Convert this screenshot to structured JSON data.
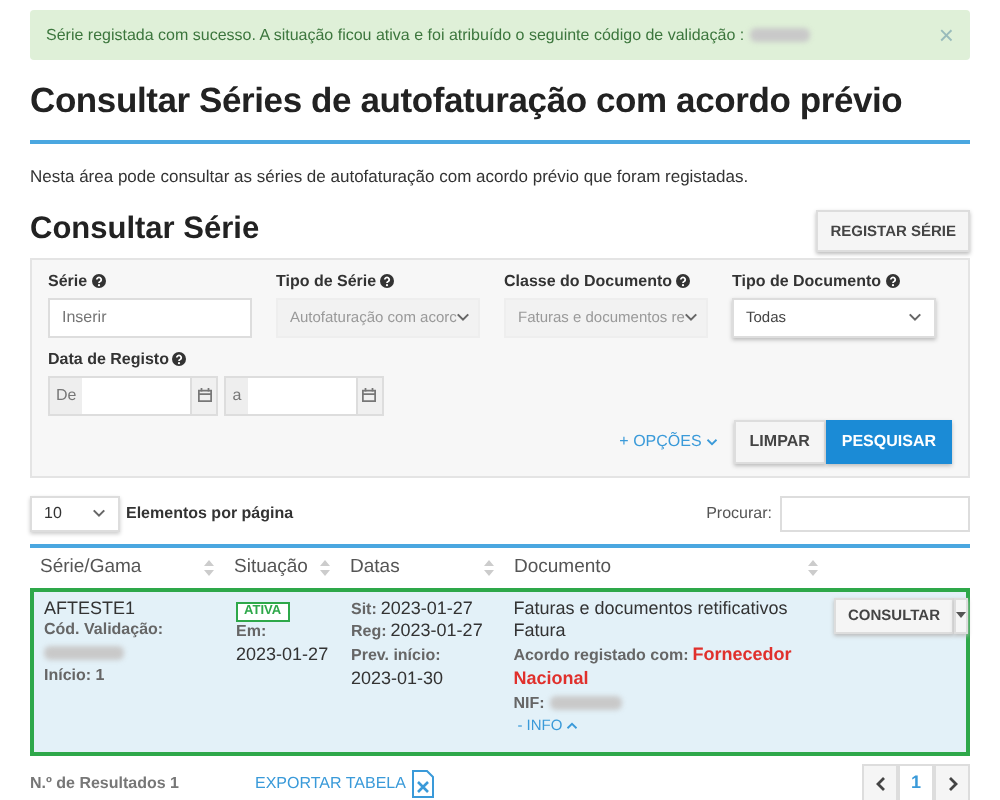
{
  "alert": {
    "text": "Série registada com sucesso. A situação ficou ativa e foi atribuído o seguinte código de validação :",
    "redacted": true,
    "dismiss": "×"
  },
  "title": "Consultar Séries de autofaturação com acordo prévio",
  "intro": "Nesta área pode consultar as séries de autofaturação com acordo prévio que foram registadas.",
  "section_title": "Consultar Série",
  "register_button": "REGISTAR SÉRIE",
  "filters": [
    {
      "kind": "input",
      "label": "Série",
      "placeholder": "Inserir"
    },
    {
      "kind": "select",
      "label": "Tipo de Série",
      "value": "Autofaturação com acorc",
      "disabled": true
    },
    {
      "kind": "select",
      "label": "Classe do Documento",
      "value": "Faturas e documentos re",
      "disabled": true
    },
    {
      "kind": "select",
      "label": "Tipo de Documento",
      "value": "Todas",
      "disabled": false
    },
    {
      "kind": "daterange",
      "label": "Data de Registo",
      "from": "De",
      "to": "a"
    }
  ],
  "options_link": "+ OPÇÕES",
  "buttons": [
    {
      "label": "LIMPAR",
      "primary": false
    },
    {
      "label": "PESQUISAR",
      "primary": true
    }
  ],
  "page_size": {
    "value": "10",
    "label": "Elementos por página"
  },
  "search": {
    "label": "Procurar:"
  },
  "table": {
    "columns": [
      {
        "label": "Série/Gama",
        "sortable": true
      },
      {
        "label": "Situação",
        "sortable": true
      },
      {
        "label": "Datas",
        "sortable": true
      },
      {
        "label": "Documento",
        "sortable": true
      }
    ],
    "rows": [
      {
        "selected": true,
        "serie": "AFTESTE1",
        "code_label": "Cód. Validação:",
        "inicio": "Início: 1",
        "status": "ATIVA",
        "em_label": "Em:",
        "em_date": "2023-01-27",
        "dates": [
          {
            "label": "Sit:",
            "value": "2023-01-27"
          },
          {
            "label": "Reg:",
            "value": "2023-01-27"
          },
          {
            "label": "Prev. início:",
            "value": "2023-01-30"
          }
        ],
        "doc_class": "Faturas e documentos retificativos",
        "doc_type": "Fatura",
        "agreement_label": "Acordo registado com:",
        "agreement_value": "Fornecedor Nacional",
        "nif_label": "NIF:",
        "info_link": "- INFO",
        "action": "CONSULTAR"
      }
    ]
  },
  "results": "N.º de Resultados 1",
  "export": "EXPORTAR TABELA",
  "pagination": [
    {
      "label": "1",
      "selected": true
    }
  ]
}
